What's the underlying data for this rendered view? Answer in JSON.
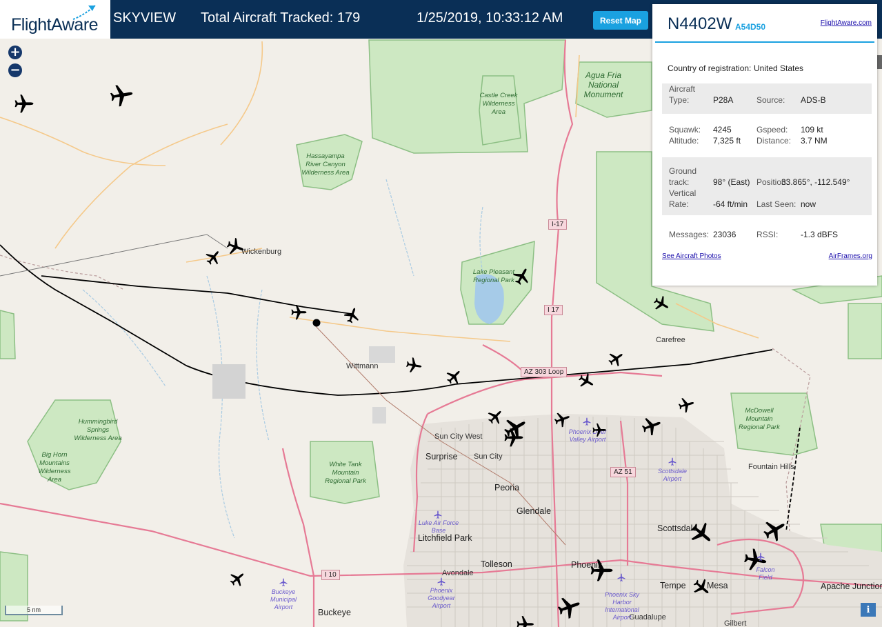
{
  "header": {
    "logo_text": "FlightAware",
    "app_name": "SKYVIEW",
    "tracked_label": "Total Aircraft Tracked: 179",
    "datetime": "1/25/2019, 10:33:12 AM",
    "reset_label": "Reset Map"
  },
  "map_controls": {
    "zoom_in": "+",
    "zoom_out": "−",
    "scale_label": "5 nm",
    "info_label": "i"
  },
  "panel": {
    "registration": "N4402W",
    "hex": "A54D50",
    "flightaware_link": "FlightAware.com",
    "country_label": "Country of registration:",
    "country_value": "United States",
    "rows": {
      "aircraft_label": "Aircraft",
      "type_label": "Type:",
      "type_value": "P28A",
      "source_label": "Source:",
      "source_value": "ADS-B",
      "squawk_label": "Squawk:",
      "squawk_value": "4245",
      "gspeed_label": "Gspeed:",
      "gspeed_value": "109 kt",
      "altitude_label": "Altitude:",
      "altitude_value": "7,325 ft",
      "distance_label": "Distance:",
      "distance_value": "3.7 NM",
      "ground_label": "Ground",
      "track_label": "track:",
      "track_value": "98° (East)",
      "position_label": "Position:",
      "position_value": "33.865°, -112.549°",
      "vertical_label": "Vertical",
      "rate_label": "Rate:",
      "rate_value": "-64 ft/min",
      "lastseen_label": "Last Seen:",
      "lastseen_value": "now",
      "messages_label": "Messages:",
      "messages_value": "23036",
      "rssi_label": "RSSI:",
      "rssi_value": "-1.3 dBFS"
    },
    "photos_link": "See Aircraft Photos",
    "airframes_link": "AirFrames.org"
  },
  "map_labels": {
    "cities": [
      "Wickenburg",
      "Wittmann",
      "Sun City West",
      "Surprise",
      "Sun City",
      "Peoria",
      "Glendale",
      "Litchfield Park",
      "Tolleson",
      "Avondale",
      "Phoenix",
      "Scottsdale",
      "Tempe",
      "Mesa",
      "Apache Junction",
      "Fountain Hills",
      "Carefree",
      "Buckeye",
      "Guadalupe",
      "Gilbert"
    ],
    "parks": [
      "Agua Fria National Monument",
      "Castle Creek Wilderness Area",
      "Hassayampa River Canyon Wilderness Area",
      "Lake Pleasant Regional Park",
      "Hummingbird Springs Wilderness Area",
      "Big Horn Mountains Wilderness Area",
      "White Tank Mountain Regional Park",
      "McDowell Mountain Regional Park"
    ],
    "airports": [
      "Luke Air Force Base",
      "Phoenix Deer Valley Airport",
      "Scottsdale Airport",
      "Buckeye Municipal Airport",
      "Phoenix Goodyear Airport",
      "Phoenix Sky Harbor International Airport",
      "Falcon Field"
    ],
    "shields": [
      "I-17",
      "I 17",
      "AZ 303 Loop",
      "AZ 51",
      "I 10"
    ]
  },
  "colors": {
    "header_bg": "#0a2f56",
    "accent": "#1aa1e0",
    "land": "#f2efe9",
    "park_green": "#cde8c2",
    "urban": "#e0ddd8",
    "highway": "#e67a95",
    "arterial": "#f5c98a",
    "track": "#000000"
  },
  "icons": {
    "aircraft": "plane-icon",
    "logo": "flightaware-logo-icon",
    "airport": "airport-icon"
  }
}
